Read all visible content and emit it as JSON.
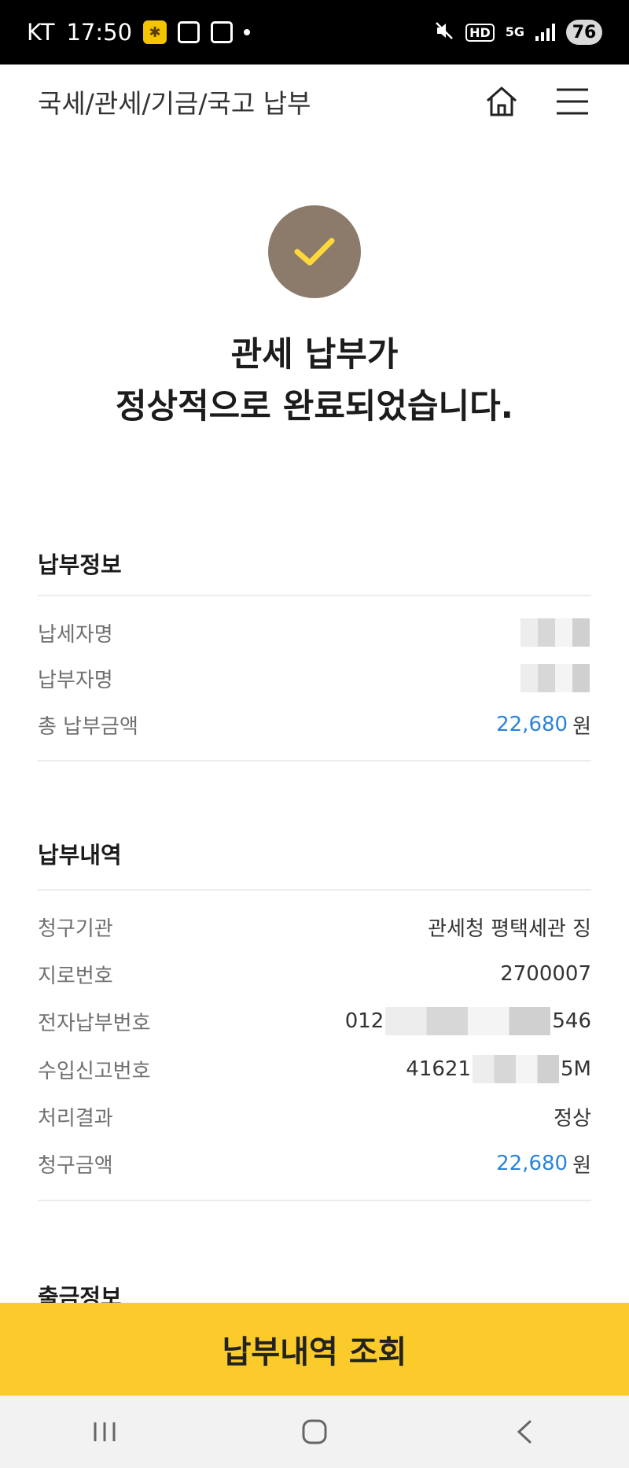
{
  "status_bar": {
    "carrier": "KT",
    "time": "17:50",
    "network_hd": "HD",
    "network_5g": "5G",
    "battery": "76",
    "icons": [
      "app-notification-icon",
      "screenshot-icon",
      "gallery-icon",
      "dot-icon",
      "mute-icon",
      "signal-icon"
    ]
  },
  "header": {
    "title": "국세/관세/기금/국고 납부",
    "icons": [
      "home-icon",
      "hamburger-menu-icon"
    ]
  },
  "result": {
    "icon": "check-icon",
    "headline_line1": "관세 납부가",
    "headline_line2": "정상적으로 완료되었습니다."
  },
  "payment_info": {
    "title": "납부정보",
    "rows": [
      {
        "label": "납세자명",
        "value": ""
      },
      {
        "label": "납부자명",
        "value": ""
      },
      {
        "label": "총 납부금액",
        "value": "22,680",
        "unit": "원"
      }
    ]
  },
  "payment_details": {
    "title": "납부내역",
    "rows": [
      {
        "label": "청구기관",
        "value": "관세청 평택세관 징"
      },
      {
        "label": "지로번호",
        "value": "2700007"
      },
      {
        "label": "전자납부번호",
        "value_prefix": "012",
        "value_suffix": "546"
      },
      {
        "label": "수입신고번호",
        "value_prefix": "41621",
        "value_suffix": "5M"
      },
      {
        "label": "처리결과",
        "value": "정상"
      },
      {
        "label": "청구금액",
        "value": "22,680",
        "unit": "원"
      }
    ]
  },
  "withdrawal_info": {
    "title": "출금정보"
  },
  "cta": {
    "label": "납부내역 조회"
  },
  "colors": {
    "accent_yellow": "#fbcb2c",
    "check_circle": "#8c7b6b",
    "amount_blue": "#2b84d9"
  },
  "nav_bar": {
    "icons": [
      "recent-apps-icon",
      "home-nav-icon",
      "back-icon"
    ]
  }
}
